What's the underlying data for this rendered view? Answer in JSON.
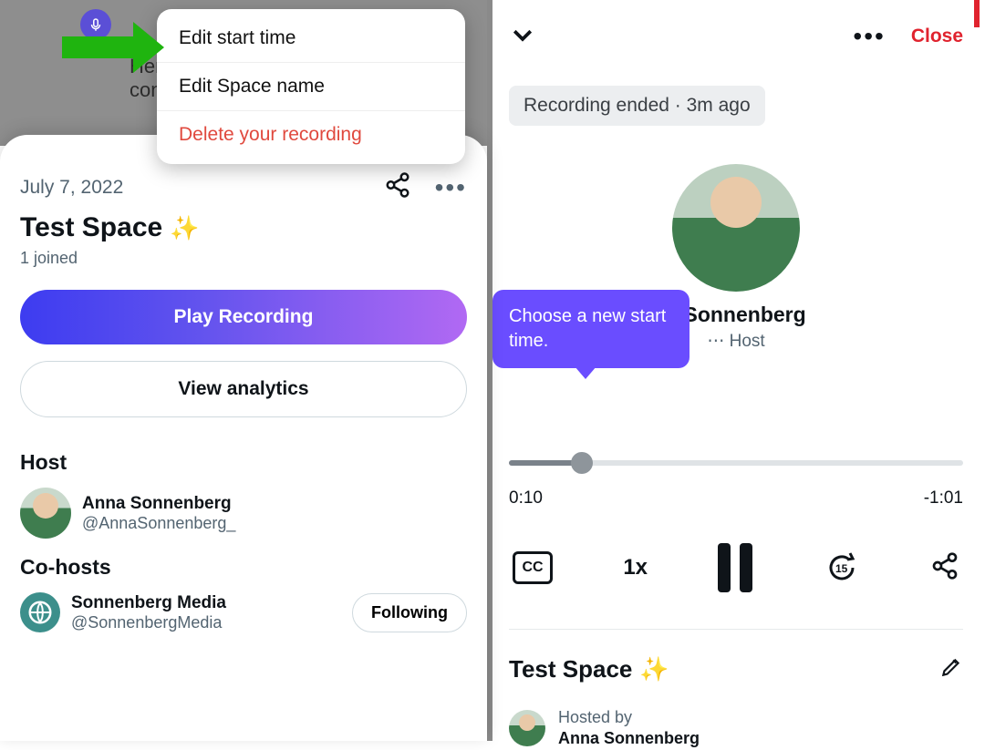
{
  "left": {
    "deep_text_line1": "Here's",
    "deep_text_line2": "conve",
    "dropdown": {
      "edit_start_time": "Edit start time",
      "edit_space_name": "Edit Space name",
      "delete_recording": "Delete your recording"
    },
    "card": {
      "date": "July 7, 2022",
      "title": "Test Space",
      "sparkle": "✨",
      "joined": "1 joined",
      "play_label": "Play Recording",
      "analytics_label": "View analytics",
      "host_heading": "Host",
      "host": {
        "name": "Anna Sonnenberg",
        "handle": "@AnnaSonnenberg_"
      },
      "cohosts_heading": "Co-hosts",
      "cohost": {
        "name": "Sonnenberg Media",
        "handle": "@SonnenbergMedia"
      },
      "following_label": "Following"
    }
  },
  "right": {
    "close_label": "Close",
    "status": "Recording ended · 3m ago",
    "center": {
      "name": "a Sonnenberg",
      "role": "Host"
    },
    "tooltip": "Choose a new start time.",
    "time": {
      "elapsed": "0:10",
      "remaining": "-1:01"
    },
    "controls": {
      "cc": "CC",
      "speed": "1x",
      "skip_seconds": "15"
    },
    "space_title": "Test Space",
    "sparkle": "✨",
    "hosted_by_label": "Hosted by",
    "hosted_by_name": "Anna Sonnenberg"
  }
}
